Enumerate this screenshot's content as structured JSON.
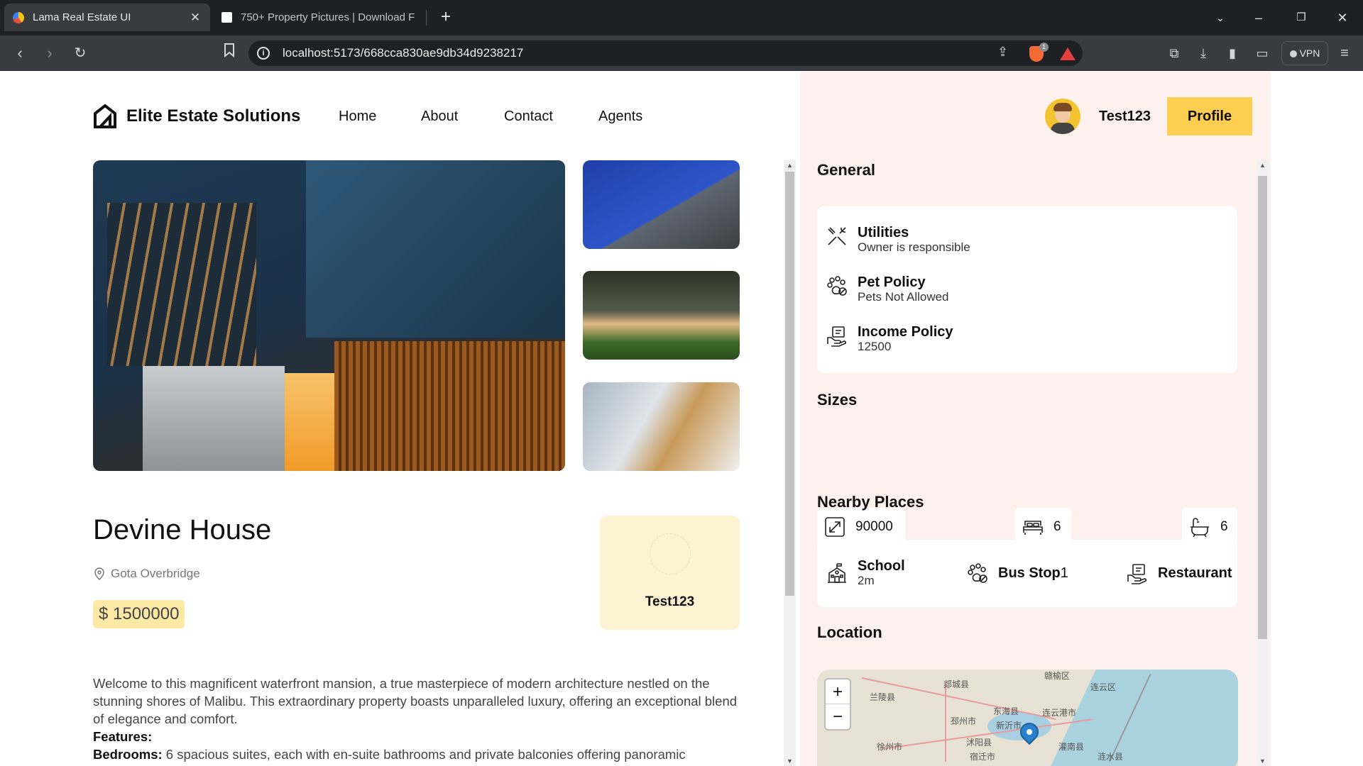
{
  "browser": {
    "tabs": [
      {
        "label": "Lama Real Estate UI",
        "active": true
      },
      {
        "label": "750+ Property Pictures | Download F",
        "active": false
      }
    ],
    "url": "localhost:5173/668cca830ae9db34d9238217",
    "vpn_label": "VPN",
    "brave_count": "1"
  },
  "header": {
    "brand": "Elite Estate Solutions",
    "nav": [
      "Home",
      "About",
      "Contact",
      "Agents"
    ],
    "username": "Test123",
    "profile_label": "Profile"
  },
  "property": {
    "title": "Devine House",
    "address": "Gota Overbridge",
    "price": "$ 1500000",
    "owner": "Test123",
    "description_intro": "Welcome to this magnificent waterfront mansion, a true masterpiece of modern architecture nestled on the stunning shores of Malibu. This extraordinary property boasts unparalleled luxury, offering an exceptional blend of elegance and comfort.",
    "features_label": "Features:",
    "bedrooms_label": "Bedrooms:",
    "bedrooms_text": " 6 spacious suites, each with en-suite bathrooms and private balconies offering panoramic"
  },
  "panel": {
    "general_title": "General",
    "general": [
      {
        "title": "Utilities",
        "value": "Owner is responsible",
        "icon": "utilities-icon"
      },
      {
        "title": "Pet Policy",
        "value": "Pets Not Allowed",
        "icon": "pet-icon"
      },
      {
        "title": "Income Policy",
        "value": "12500",
        "icon": "income-icon"
      }
    ],
    "sizes_title": "Sizes",
    "sizes": {
      "area": "90000",
      "bedrooms": "6",
      "bathrooms": "6"
    },
    "nearby_title": "Nearby Places",
    "nearby": [
      {
        "title": "School",
        "value": "2m",
        "icon": "school-icon"
      },
      {
        "title": "Bus Stop",
        "value": "1",
        "icon": "bus-icon"
      },
      {
        "title": "Restaurant",
        "value": "",
        "icon": "restaurant-icon"
      }
    ],
    "location_title": "Location",
    "map": {
      "zoom_in": "+",
      "zoom_out": "−",
      "labels": [
        "赣榆区",
        "连云区",
        "东海县",
        "连云港市",
        "邳州市",
        "新沂市",
        "灌南县",
        "徐州市",
        "宿迁市",
        "涟水县",
        "沭阳县",
        "兰陵县",
        "郯城县"
      ]
    }
  },
  "colors": {
    "accent": "#fece51",
    "panel_bg": "#fcf1ed",
    "price_bg": "#fde9a6",
    "owner_bg": "#fdf3d2"
  }
}
